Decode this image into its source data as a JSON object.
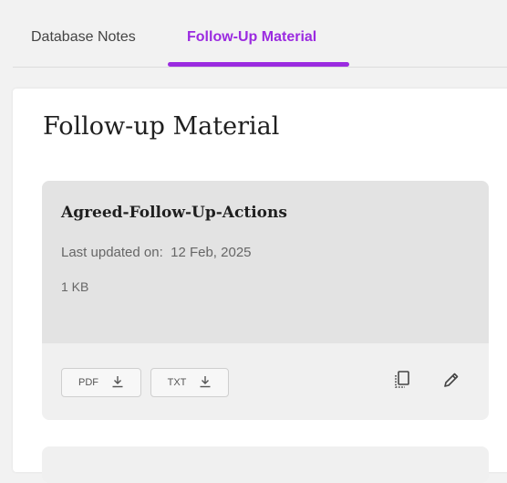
{
  "tabs": [
    {
      "label": "Database Notes",
      "active": false
    },
    {
      "label": "Follow-Up Material",
      "active": true
    }
  ],
  "colors": {
    "accent": "#9b2be0",
    "card_top": "#e3e3e3",
    "card_bottom": "#f0f0f0"
  },
  "panel": {
    "title": "Follow-up Material"
  },
  "card": {
    "name": "Agreed-Follow-Up-Actions",
    "updated_label": "Last updated on:",
    "updated_date": "12 Feb, 2025",
    "size": "1 KB",
    "downloads": [
      {
        "label": "PDF",
        "icon": "download-icon"
      },
      {
        "label": "TXT",
        "icon": "download-icon"
      }
    ],
    "actions": [
      {
        "icon": "copy-icon"
      },
      {
        "icon": "pencil-icon"
      }
    ]
  }
}
